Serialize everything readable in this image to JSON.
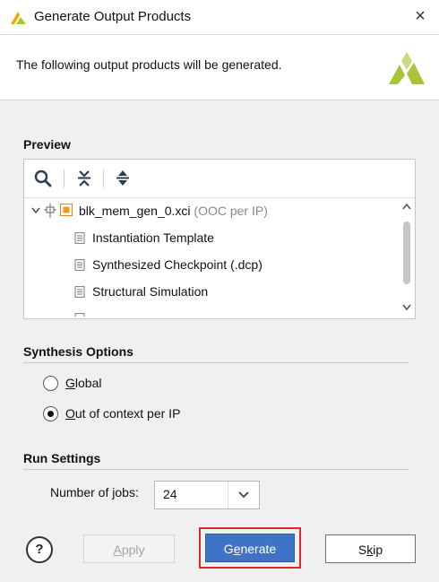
{
  "window": {
    "title": "Generate Output Products",
    "close_glyph": "×"
  },
  "header": {
    "text": "The following output products will be generated."
  },
  "preview": {
    "heading": "Preview",
    "tree": {
      "root": {
        "name": "blk_mem_gen_0.xci",
        "suffix": "(OOC per IP)"
      },
      "children": [
        "Instantiation Template",
        "Synthesized Checkpoint (.dcp)",
        "Structural Simulation"
      ]
    }
  },
  "synthesis": {
    "heading": "Synthesis Options",
    "options": [
      {
        "accel": "G",
        "rest": "lobal",
        "selected": false
      },
      {
        "accel": "O",
        "rest": "ut of context per IP",
        "selected": true
      }
    ]
  },
  "run": {
    "heading": "Run Settings",
    "jobs_label_pre": "Number of ",
    "jobs_label_accel": "j",
    "jobs_label_post": "obs:",
    "jobs_value": "24"
  },
  "buttons": {
    "help": "?",
    "apply_accel": "A",
    "apply_rest": "pply",
    "generate_pre": "G",
    "generate_accel": "e",
    "generate_post": "nerate",
    "skip_pre": "S",
    "skip_accel": "k",
    "skip_post": "ip"
  },
  "colors": {
    "accent": "#3f73c6",
    "highlight": "#e0262d",
    "xilinx_green": "#a8c43a"
  }
}
